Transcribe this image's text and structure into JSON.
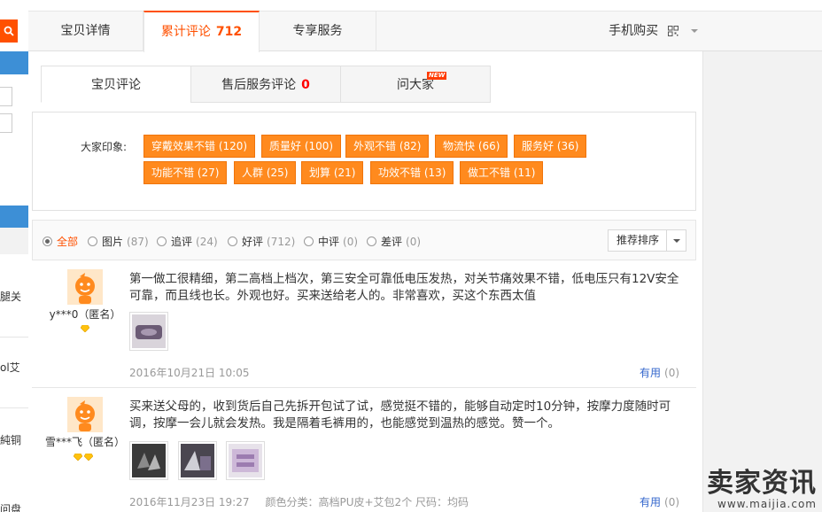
{
  "top_tabs": [
    {
      "label": "宝贝详情"
    },
    {
      "label": "累计评论",
      "count": "712"
    },
    {
      "label": "专享服务"
    }
  ],
  "mobile_buy": "手机购买",
  "left_clip": {
    "line1": "腿关",
    "line2": "ol艾",
    "line3": "純铜",
    "line4": "问盘"
  },
  "sub_tabs": [
    {
      "label": "宝贝评论"
    },
    {
      "label": "售后服务评论",
      "count": "0"
    },
    {
      "label": "问大家",
      "badge": "NEW"
    }
  ],
  "impressions": {
    "label": "大家印象:",
    "tags": [
      "穿戴效果不错 (120)",
      "质量好 (100)",
      "外观不错 (82)",
      "物流快 (66)",
      "服务好 (36)",
      "功能不错 (27)",
      "人群 (25)",
      "划算 (21)",
      "功效不错 (13)",
      "做工不错 (11)"
    ]
  },
  "filters": [
    {
      "label": "全部",
      "count": "",
      "selected": true
    },
    {
      "label": "图片",
      "count": "(87)"
    },
    {
      "label": "追评",
      "count": "(24)"
    },
    {
      "label": "好评",
      "count": "(712)"
    },
    {
      "label": "中评",
      "count": "(0)"
    },
    {
      "label": "差评",
      "count": "(0)"
    }
  ],
  "sort_label": "推荐排序",
  "reviews": [
    {
      "user": "y***0（匿名）",
      "text": "第一做工很精细，第二高档上档次，第三安全可靠低电压发热，对关节痛效果不错，低电压只有12V安全可靠，而且线也长。外观也好。买来送给老人的。非常喜欢，买这个东西太值",
      "date": "2016年10月21日 10:05",
      "meta": "",
      "useful_label": "有用",
      "useful_count": "(0)",
      "level": 1
    },
    {
      "user": "雪***飞（匿名）",
      "text": "买来送父母的，收到货后自己先拆开包试了试，感觉挺不错的，能够自动定时10分钟，按摩力度随时可调，按摩一会儿就会发热。我是隔着毛裤用的，也能感觉到温热的感觉。赞一个。",
      "date": "2016年11月23日 19:27",
      "meta": "颜色分类：高档PU皮+艾包2个  尺码：均码",
      "useful_label": "有用",
      "useful_count": "(0)",
      "level": 2
    }
  ],
  "watermark": {
    "main": "卖家资讯",
    "sub": "www.maijia.com"
  },
  "colors": {
    "accent": "#ff5000",
    "tag_bg": "#ff8a1e",
    "link": "#3366cc",
    "side_blue": "#3d8fd6"
  }
}
